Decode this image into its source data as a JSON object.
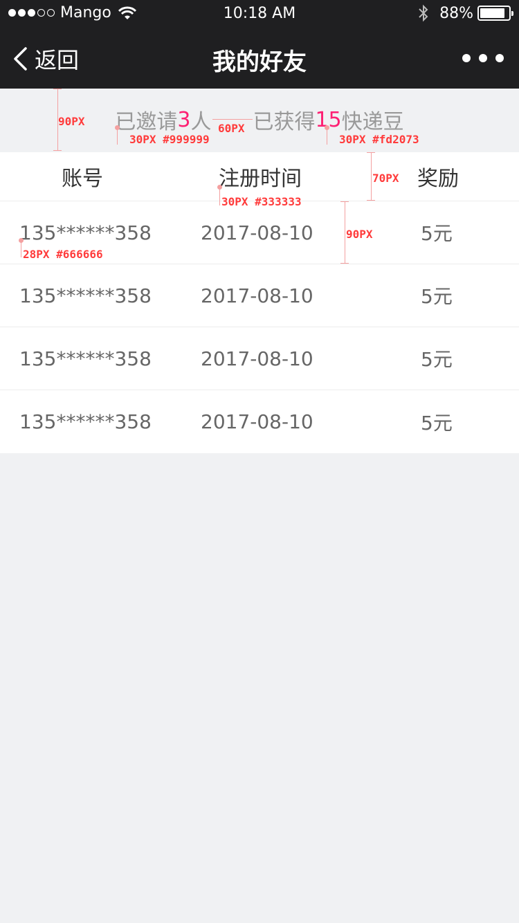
{
  "status_bar": {
    "carrier": "Mango",
    "time": "10:18 AM",
    "battery_percent": "88%",
    "battery_level": 0.88,
    "signal_bars": 3,
    "signal_total": 5
  },
  "nav": {
    "back_label": "返回",
    "title": "我的好友"
  },
  "summary": {
    "invited_prefix": "已邀请",
    "invited_count": "3",
    "invited_suffix": "人",
    "earned_prefix": "已获得",
    "earned_count": "15",
    "earned_suffix": "快递豆"
  },
  "table": {
    "headers": [
      "账号",
      "注册时间",
      "奖励"
    ],
    "rows": [
      [
        "135******358",
        "2017-08-10",
        "5元"
      ],
      [
        "135******358",
        "2017-08-10",
        "5元"
      ],
      [
        "135******358",
        "2017-08-10",
        "5元"
      ],
      [
        "135******358",
        "2017-08-10",
        "5元"
      ]
    ]
  },
  "annotations": {
    "summary_height": "90PX",
    "summary_gap": "60PX",
    "summary_gray_spec": "30PX #999999",
    "summary_pink_spec": "30PX #fd2073",
    "header_height": "70PX",
    "header_spec": "30PX #333333",
    "row_height": "90PX",
    "row_spec": "28PX #666666"
  },
  "colors": {
    "nav_background": "#1f1f21",
    "page_background": "#f0f1f3",
    "accent": "#fd2073",
    "summary_text": "#999999",
    "header_text": "#333333",
    "row_text": "#666666",
    "annotation": "#ff3b3b"
  },
  "icons": {
    "back": "chevron-left-icon",
    "more": "more-dots-icon",
    "wifi": "wifi-icon",
    "bluetooth": "bluetooth-icon",
    "battery": "battery-icon"
  }
}
